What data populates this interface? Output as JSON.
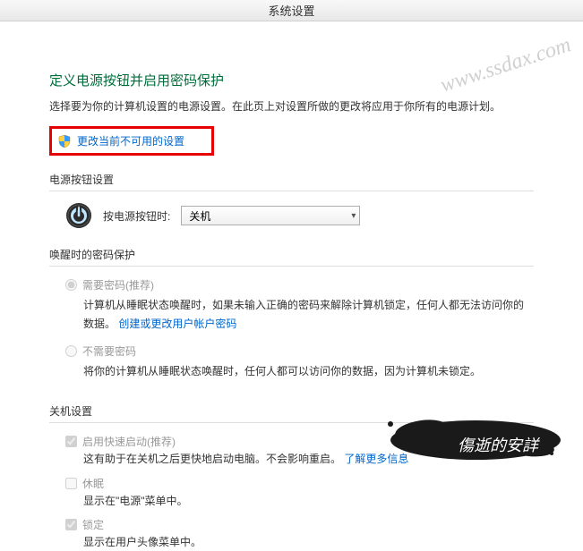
{
  "titlebar": "系统设置",
  "heading": "定义电源按钮并启用密码保护",
  "description": "选择要为你的计算机设置的电源设置。在此页上对设置所做的更改将应用于你所有的电源计划。",
  "change_link": "更改当前不可用的设置",
  "section_power_button": "电源按钮设置",
  "power_button_label": "按电源按钮时:",
  "power_button_value": "关机",
  "section_password": "唤醒时的密码保护",
  "radio": {
    "require": {
      "label": "需要密码(推荐)",
      "desc_prefix": "计算机从睡眠状态唤醒时，如果未输入正确的密码来解除计算机锁定，任何人都无法访问你的数据。",
      "link": "创建或更改用户帐户密码"
    },
    "no_require": {
      "label": "不需要密码",
      "desc": "将你的计算机从睡眠状态唤醒时，任何人都可以访问你的数据，因为计算机未锁定。"
    }
  },
  "section_shutdown": "关机设置",
  "checks": {
    "fast": {
      "label": "启用快速启动(推荐)",
      "desc_prefix": "这有助于在关机之后更快地启动电脑。不会影响重启。",
      "link": "了解更多信息"
    },
    "sleep": {
      "label": "休眠",
      "desc": "显示在\"电源\"菜单中。"
    },
    "lock": {
      "label": "锁定",
      "desc": "显示在用户头像菜单中。"
    }
  },
  "watermark1": "www.ssdax.com",
  "watermark2": "傷逝的安詳"
}
